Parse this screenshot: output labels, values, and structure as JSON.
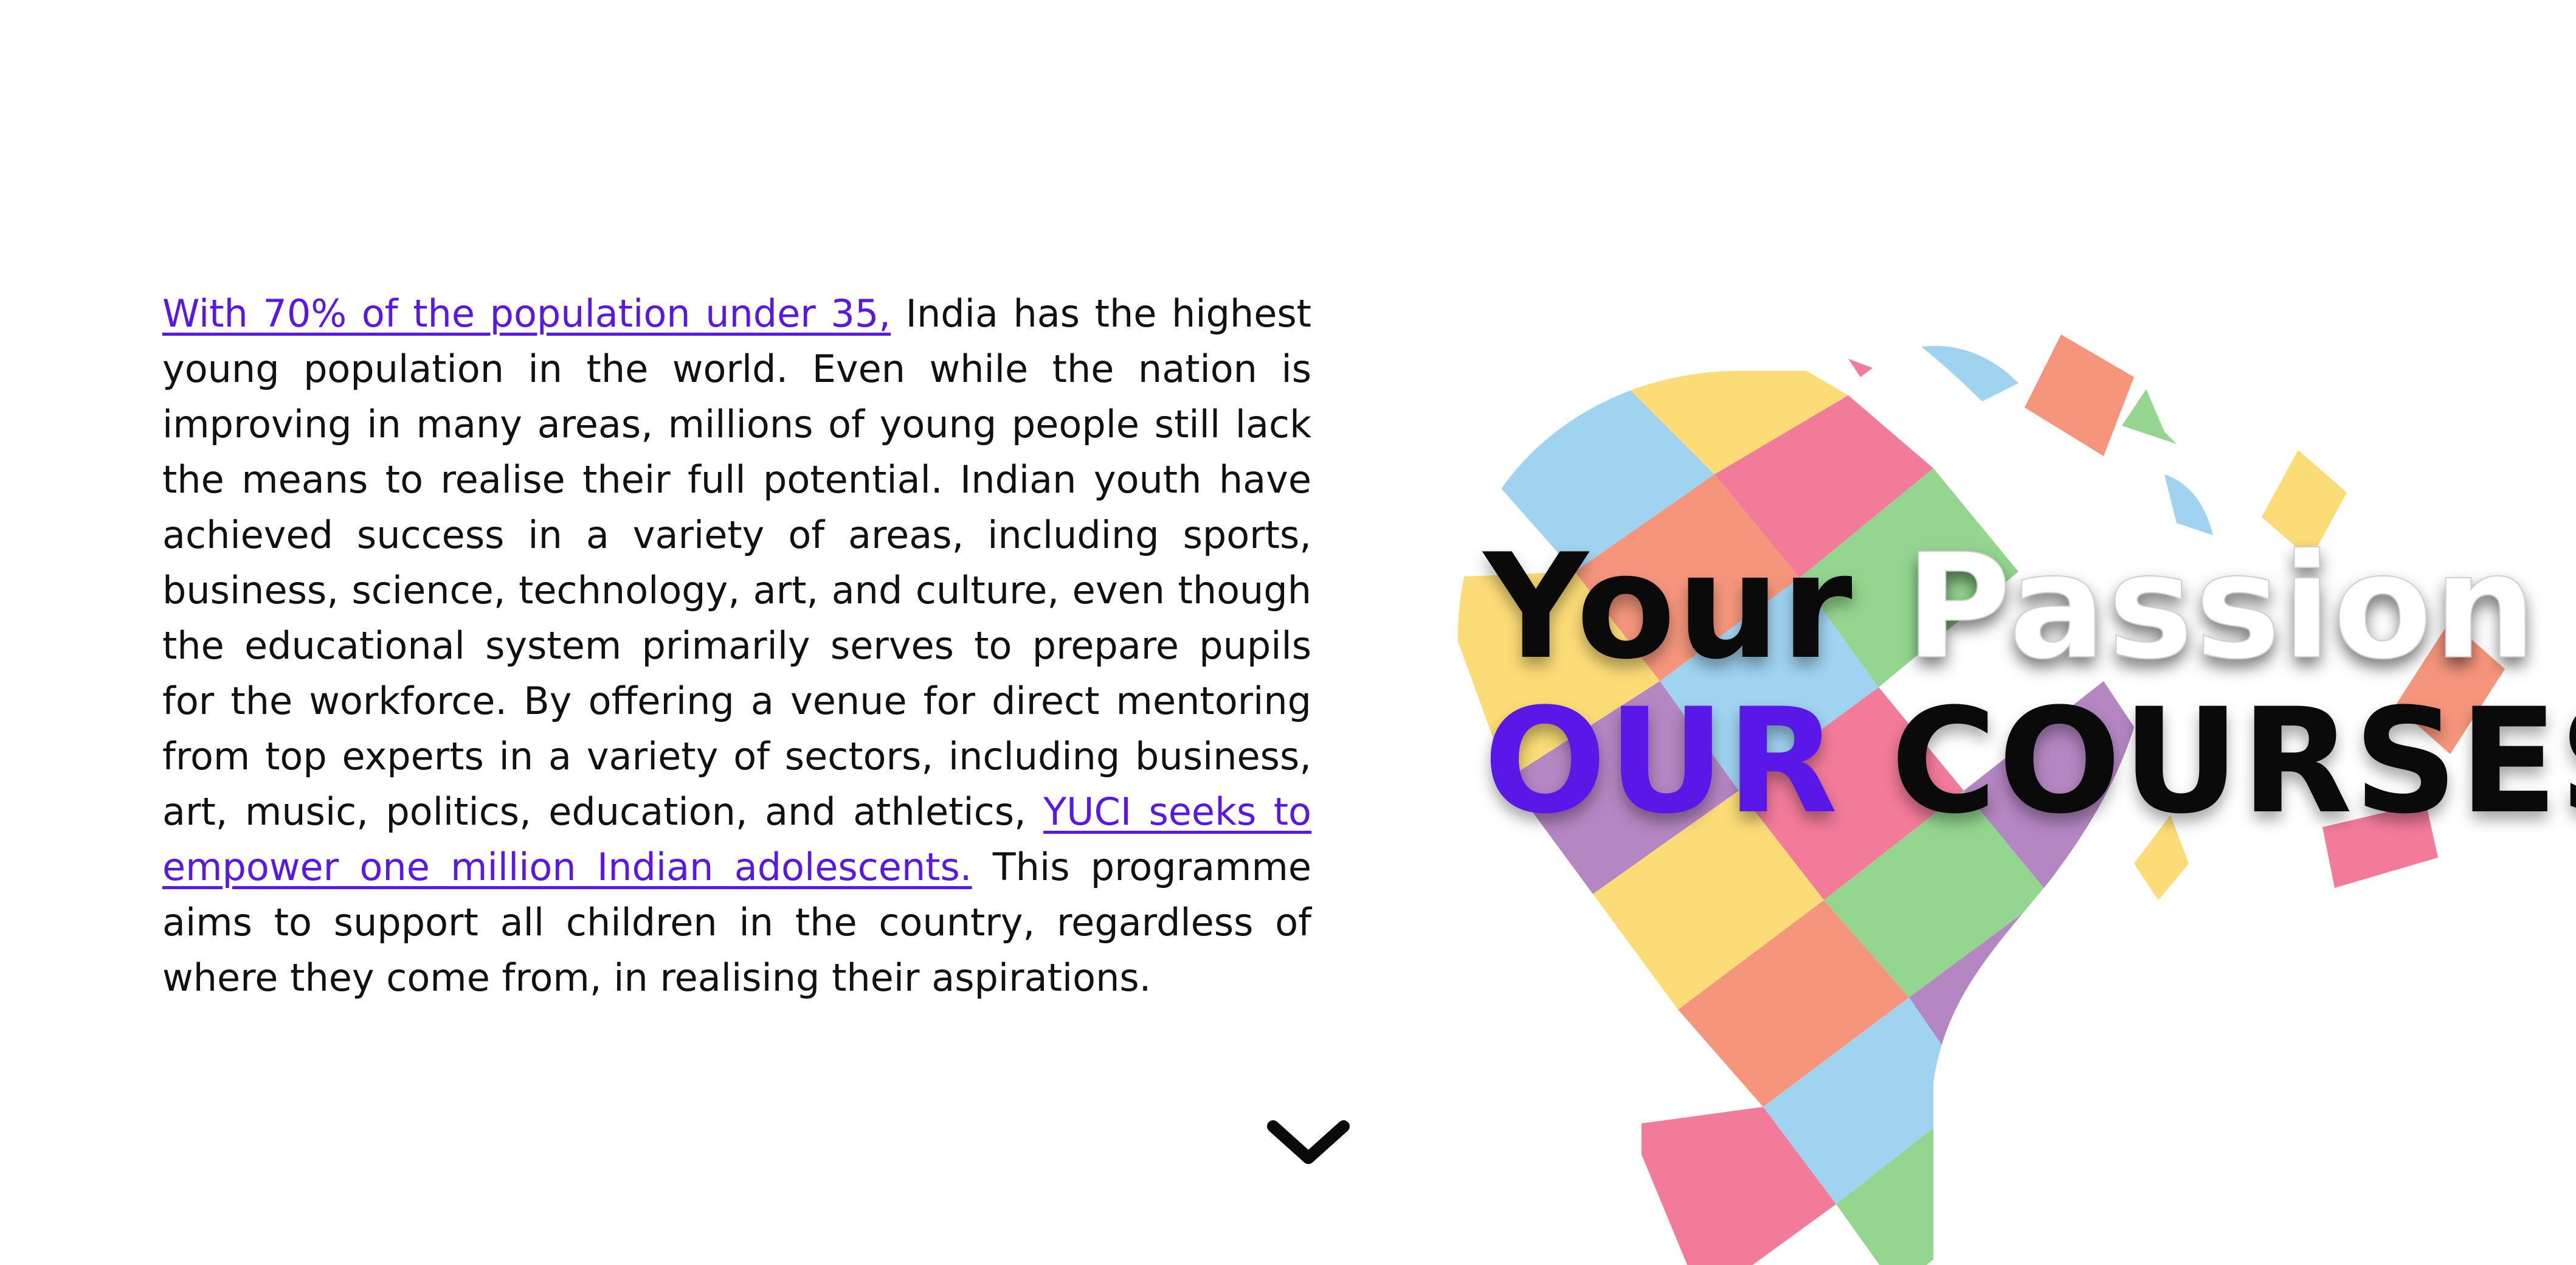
{
  "intro": {
    "link1": "With 70% of the population under 35,",
    "text1": " India has the highest young population in the world. Even while the nation is improving in many areas, millions of young people still lack the means to realise their full potential. Indian youth have achieved success in a variety of areas, including sports, business, science, technology, art, and culture, even though the educational system primarily serves to prepare pupils for the workforce. By offering a venue for direct mentoring from top experts in a variety of sectors, including business, art, music, politics, education, and athletics, ",
    "link2": "YUCI seeks to empower one million Indian adolescents.",
    "text2": " This programme aims to support all children in the country, regardless of where they come from, in realising their aspirations."
  },
  "headline": {
    "word1": "Your",
    "word2": "Passion",
    "word3": "OUR",
    "word4": "COURSES"
  },
  "icons": {
    "scroll": "chevron-down-icon",
    "art": "mosaic-lightbulb-illustration"
  },
  "colors": {
    "accent": "#5a18e8",
    "text": "#111111",
    "tile_blue": "#9fd3f0",
    "tile_yellow": "#fbdc76",
    "tile_pink": "#f27b99",
    "tile_green": "#94d690",
    "tile_purple": "#b486c2",
    "tile_salmon": "#f5967c"
  }
}
